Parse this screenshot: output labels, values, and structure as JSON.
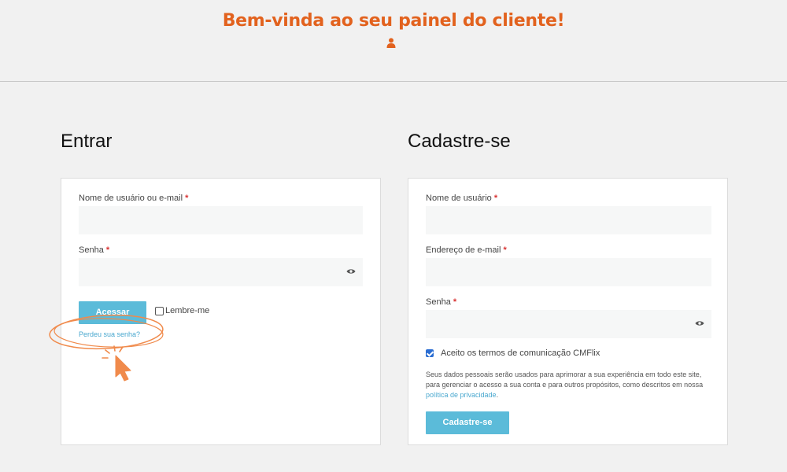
{
  "header": {
    "welcome": "Bem-vinda ao seu painel do cliente!",
    "icon": "user-icon",
    "accent_color": "#e2621e"
  },
  "login": {
    "title": "Entrar",
    "username_label": "Nome de usuário ou e-mail",
    "username_value": "",
    "password_label": "Senha",
    "password_value": "",
    "required_mark": "*",
    "submit_label": "Acessar",
    "remember_label": "Lembre-me",
    "remember_checked": false,
    "lost_password": "Perdeu sua senha?"
  },
  "register": {
    "title": "Cadastre-se",
    "username_label": "Nome de usuário",
    "username_value": "",
    "email_label": "Endereço de e-mail",
    "email_value": "",
    "password_label": "Senha",
    "password_value": "",
    "required_mark": "*",
    "terms_label": "Aceito os termos de comunicação CMFlix",
    "terms_checked": true,
    "privacy_text": "Seus dados pessoais serão usados para aprimorar a sua experiência em todo este site, para gerenciar o acesso a sua conta e para outros propósitos, como descritos em nossa",
    "privacy_link": "política de privacidade",
    "privacy_end": ".",
    "submit_label": "Cadastre-se"
  },
  "colors": {
    "button": "#5bbbd9",
    "link": "#4aa8cf",
    "annotation": "#f08a4b"
  }
}
